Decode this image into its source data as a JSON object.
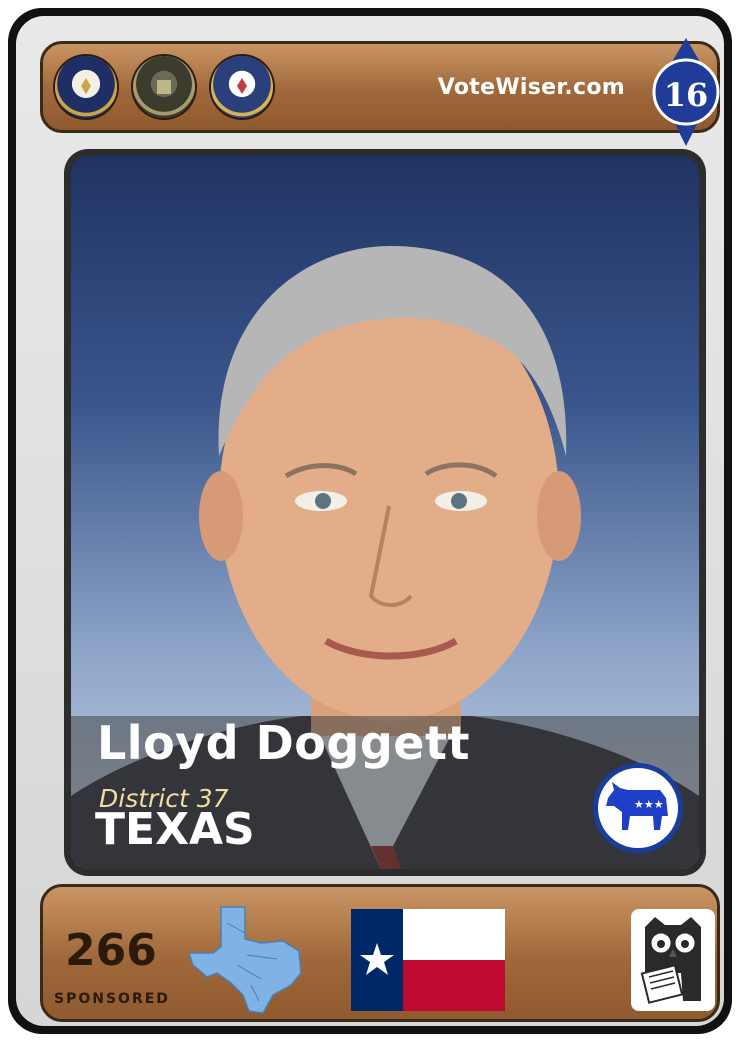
{
  "header": {
    "site": "VoteWiser.com",
    "rank": "16",
    "seals": [
      "house-seal-icon",
      "library-seal-icon",
      "congress-seal-icon"
    ]
  },
  "profile": {
    "name": "Lloyd Doggett",
    "district": "District 37",
    "state": "TEXAS",
    "party": "democrat"
  },
  "footer": {
    "sponsored_count": "266",
    "sponsored_label": "SPONSORED"
  },
  "colors": {
    "bar": "#a0683a",
    "badge_blue": "#1f3c98",
    "party_blue": "#1a3c9e",
    "flag_blue": "#002868",
    "flag_red": "#bf0a30",
    "map_blue": "#7fb2e5"
  }
}
